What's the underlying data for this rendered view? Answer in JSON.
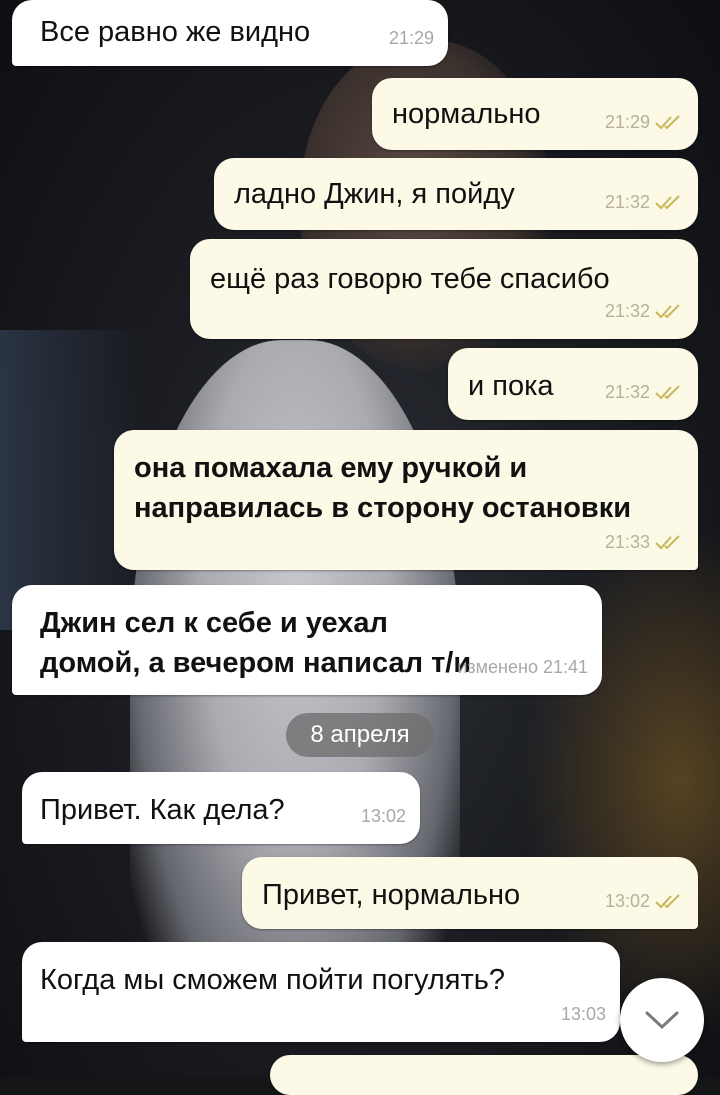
{
  "messages": [
    {
      "text": "Все равно же видно",
      "time": "21:29"
    },
    {
      "text": "нормально",
      "time": "21:29"
    },
    {
      "text": "ладно Джин, я пойду",
      "time": "21:32"
    },
    {
      "text": "ещё раз говорю тебе спасибо",
      "time": "21:32"
    },
    {
      "text": "и пока",
      "time": "21:32"
    },
    {
      "text": "она помахала ему ручкой и направилась в сторону остановки",
      "time": "21:33"
    },
    {
      "text": "Джин сел к себе и уехал домой, а вечером написал т/и",
      "time": "изменено 21:41"
    },
    {
      "text": "Привет. Как дела?",
      "time": "13:02"
    },
    {
      "text": "Привет, нормально",
      "time": "13:02"
    },
    {
      "text": "Когда мы сможем пойти погулять?",
      "time": "13:03"
    }
  ],
  "date_separator": "8 апреля",
  "icons": {
    "read_receipt": "double-check-icon",
    "scroll_down": "chevron-down-icon"
  },
  "colors": {
    "incoming_bubble": "#ffffff",
    "outgoing_bubble": "#fcf9e7",
    "read_check": "#c9b75a",
    "date_pill": "#6e6e6e"
  }
}
